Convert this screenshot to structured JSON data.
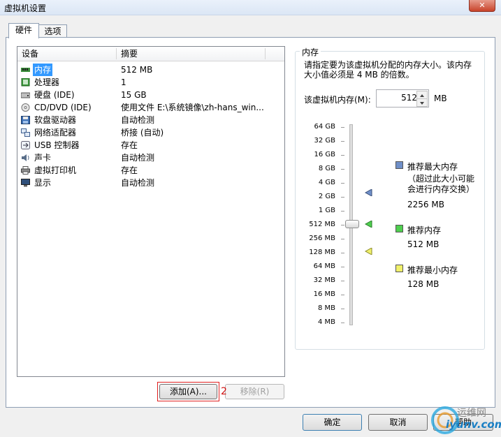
{
  "window": {
    "title": "虚拟机设置",
    "close_label": "✕"
  },
  "tabs": [
    {
      "label": "硬件",
      "active": true
    },
    {
      "label": "选项",
      "active": false
    }
  ],
  "device_list": {
    "columns": [
      "设备",
      "摘要"
    ],
    "rows": [
      {
        "icon": "memory-icon",
        "name": "内存",
        "summary": "512 MB",
        "selected": true
      },
      {
        "icon": "processor-icon",
        "name": "处理器",
        "summary": "1"
      },
      {
        "icon": "hard-disk-icon",
        "name": "硬盘 (IDE)",
        "summary": "15 GB"
      },
      {
        "icon": "cd-dvd-icon",
        "name": "CD/DVD (IDE)",
        "summary": "使用文件 E:\\系统镜像\\zh-hans_win..."
      },
      {
        "icon": "floppy-icon",
        "name": "软盘驱动器",
        "summary": "自动检测"
      },
      {
        "icon": "network-adapter-icon",
        "name": "网络适配器",
        "summary": "桥接 (自动)"
      },
      {
        "icon": "usb-icon",
        "name": "USB 控制器",
        "summary": "存在"
      },
      {
        "icon": "sound-icon",
        "name": "声卡",
        "summary": "自动检测"
      },
      {
        "icon": "printer-icon",
        "name": "虚拟打印机",
        "summary": "存在"
      },
      {
        "icon": "display-icon",
        "name": "显示",
        "summary": "自动检测"
      }
    ]
  },
  "buttons": {
    "add": "添加(A)...",
    "remove": "移除(R)",
    "ok": "确定",
    "cancel": "取消",
    "help": "帮助"
  },
  "annotation": {
    "marker": "2"
  },
  "memory": {
    "group_label": "内存",
    "description": "请指定要为该虚拟机分配的内存大小。该内存大小值必须是 4 MB 的倍数。",
    "field_label": "该虚拟机内存(M):",
    "value": "512",
    "unit": "MB",
    "scale": [
      "64 GB",
      "32 GB",
      "16 GB",
      "8 GB",
      "4 GB",
      "2 GB",
      "1 GB",
      "512 MB",
      "256 MB",
      "128 MB",
      "64 MB",
      "32 MB",
      "16 MB",
      "8 MB",
      "4 MB"
    ],
    "slider_value": "512 MB",
    "legend": [
      {
        "color": "#6f8fc8",
        "title": "推荐最大内存",
        "note": "（超过此大小可能会进行内存交换）",
        "value": "2256 MB"
      },
      {
        "color": "#4fcf4f",
        "title": "推荐内存",
        "value": "512 MB"
      },
      {
        "color": "#f0f06a",
        "title": "推荐最小内存",
        "value": "128 MB"
      }
    ]
  },
  "watermark": {
    "brand": "运维网",
    "domain": "iyunv.com"
  }
}
